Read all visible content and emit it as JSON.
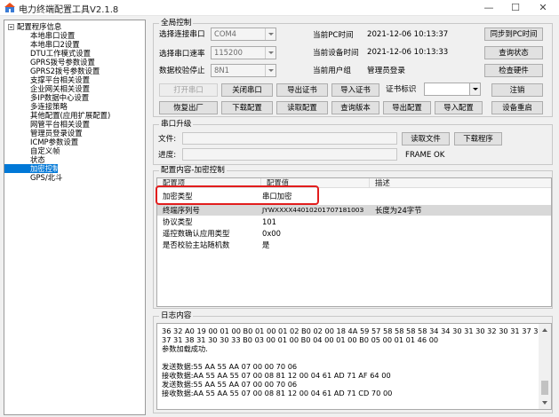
{
  "window": {
    "title": "电力终端配置工具V2.1.8",
    "minimize": "—",
    "maximize": "☐",
    "close": "✕"
  },
  "tree": {
    "root": "配置程序信息",
    "items": [
      "本地串口设置",
      "本地串口2设置",
      "DTU工作模式设置",
      "GPRS拨号参数设置",
      "GPRS2拨号参数设置",
      "支撑平台相关设置",
      "企业网关相关设置",
      "多IP数据中心设置",
      "多连接策略",
      "其他配置(应用扩展配置)",
      "网管平台相关设置",
      "管理员登录设置",
      "ICMP参数设置",
      "自定义帧",
      "状态",
      "加密控制",
      "GPS/北斗"
    ],
    "selected_index": 15
  },
  "global": {
    "title": "全局控制",
    "port_label": "选择连接串口",
    "port_value": "COM4",
    "baud_label": "选择串口速率",
    "baud_value": "115200",
    "parity_label": "数据校验停止",
    "parity_value": "8N1",
    "pc_time_label": "当前PC时间",
    "pc_time_value": "2021-12-06 10:13:37",
    "dev_time_label": "当前设备时间",
    "dev_time_value": "2021-12-06 10:13:33",
    "user_label": "当前用户组",
    "user_value": "管理员登录",
    "btn_sync": "同步到PC时间",
    "btn_query_status": "查询状态",
    "btn_check_hw": "检查硬件",
    "btn_open_port": "打开串口",
    "btn_close_port": "关闭串口",
    "btn_export_cert": "导出证书",
    "btn_import_cert": "导入证书",
    "cert_label": "证书标识",
    "cert_value": "",
    "btn_logout": "注销",
    "btn_factory": "恢复出厂",
    "btn_download_cfg": "下载配置",
    "btn_read_cfg": "读取配置",
    "btn_query_version": "查询版本",
    "btn_export_cfg": "导出配置",
    "btn_import_cfg": "导入配置",
    "btn_reboot": "设备重启"
  },
  "upgrade": {
    "title": "串口升级",
    "file_label": "文件:",
    "file_value": "",
    "progress_label": "进度:",
    "progress_value": 0,
    "btn_read_file": "读取文件",
    "btn_download_prog": "下载程序",
    "status": "FRAME OK"
  },
  "config": {
    "title": "配置内容-加密控制",
    "columns": [
      "配置项",
      "配置值",
      "描述"
    ],
    "rows": [
      {
        "item": "加密类型",
        "value": "串口加密",
        "desc": ""
      },
      {
        "item": "终端序列号",
        "value": "JYWXXXX4401020170718100З",
        "desc": "长度为24字节"
      },
      {
        "item": "协议类型",
        "value": "101",
        "desc": ""
      },
      {
        "item": "遥控数确认应用类型",
        "value": "0x00",
        "desc": ""
      },
      {
        "item": "是否校验主站随机数",
        "value": "是",
        "desc": ""
      }
    ],
    "selected_row": 1,
    "highlight_color": "#e21d1d"
  },
  "log": {
    "title": "日志内容",
    "lines": [
      "36 32 A0 19 00 01 00 B0 01 00 01 02 B0 02 00 18 4A 59 57 58 58 58 58 34 34 30 31 30 32 30 31 37 30",
      "37 31 38 31 30 30 33 B0 03 00 01 00 B0 04 00 01 00 B0 05 00 01 01 46 00",
      "参数加载成功.",
      "",
      "发送数据:55 AA 55 AA 07 00 00 70 06",
      "接收数据:AA 55 AA 55 07 00 08 81 12 00 04 61 AD 71 AF 64 00",
      "发送数据:55 AA 55 AA 07 00 00 70 06",
      "接收数据:AA 55 AA 55 07 00 08 81 12 00 04 61 AD 71 CD 70 00"
    ]
  }
}
